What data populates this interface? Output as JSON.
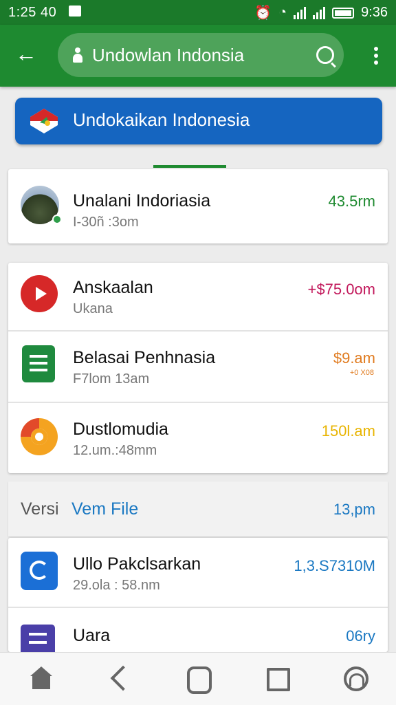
{
  "status_bar": {
    "time": "1:25 40",
    "battery_time": "9:36"
  },
  "app_bar": {
    "search_query": "Undowlan Indonsia"
  },
  "banner": {
    "title": "Undokaikan Indonesia"
  },
  "featured": {
    "title": "Unalani Indoriasia",
    "subtitle": "I-30ñ :3om",
    "value": "43.5rm",
    "value_color": "#1e8a30"
  },
  "list": [
    {
      "icon": "play-icon",
      "title": "Anskaalan",
      "subtitle": "Ukana",
      "value": "+$75.0om",
      "value_color": "#c2185b"
    },
    {
      "icon": "document-icon",
      "title": "Belasai Penhnasia",
      "subtitle": "F7lom 13am",
      "value": "$9.am",
      "subvalue": "+0 X08",
      "value_color": "#e07b1f"
    },
    {
      "icon": "chart-icon",
      "title": "Dustlomudia",
      "subtitle": "12.um.:48mm",
      "value": "150l.am",
      "value_color": "#e8b400"
    }
  ],
  "section": {
    "label_a": "Versi",
    "label_b": "Vem File",
    "value": "13,pm"
  },
  "list2": [
    {
      "icon": "shield-icon",
      "title": "Ullo Pakclsarkan",
      "subtitle": "29.ola : 58.nm",
      "value": "1,3.S7310M",
      "value_color": "#1a78c2"
    },
    {
      "icon": "file-icon",
      "title": "Uara",
      "subtitle": "",
      "value": "06ry",
      "value_color": "#1a78c2"
    }
  ]
}
